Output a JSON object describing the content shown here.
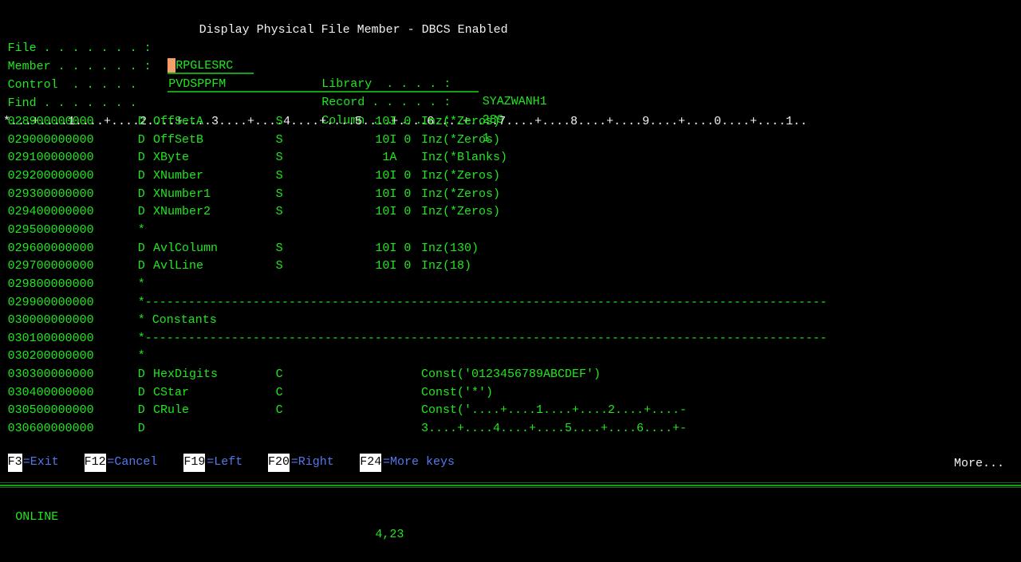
{
  "screen": {
    "title": "Display Physical File Member - DBCS Enabled",
    "more_indicator": "More...",
    "char_width": 9.6,
    "colors": {
      "green": "#1ee81e",
      "white": "#f2f2f2",
      "blue": "#5577ee",
      "cursor": "#f5a06a",
      "background": "#000000",
      "fkey_badge_bg": "#ffffff",
      "fkey_badge_fg": "#000000"
    }
  },
  "header": {
    "fields": [
      {
        "label": "File . . . . . . . :",
        "value": "QRPGLESRC"
      },
      {
        "label": "Member . . . . . . :",
        "value": "PVDSPPFM"
      },
      {
        "label": "Control  . . . . .",
        "value": ""
      },
      {
        "label": "Find . . . . . . .",
        "value": ""
      }
    ],
    "right_fields": [
      {
        "label": "Library  . . . . :",
        "value": "SYAZWANH1"
      },
      {
        "label": "Record . . . . . :",
        "value": "289"
      },
      {
        "label": "Column . . . . . :",
        "value": "1"
      }
    ]
  },
  "ruler": "*...+....1....+....2....+....3....+....4....+....5....+....6....+....7....+....8....+....9....+....0....+....1..",
  "listing": [
    {
      "seq": "028900000000",
      "spec": "D",
      "name": "OffSetA",
      "type": "S",
      "len": "10I 0",
      "keyword": "Inz(*Zeros)"
    },
    {
      "seq": "029000000000",
      "spec": "D",
      "name": "OffSetB",
      "type": "S",
      "len": "10I 0",
      "keyword": "Inz(*Zeros)"
    },
    {
      "seq": "029100000000",
      "spec": "D",
      "name": "XByte",
      "type": "S",
      "len": " 1A ",
      "keyword": "Inz(*Blanks)"
    },
    {
      "seq": "029200000000",
      "spec": "D",
      "name": "XNumber",
      "type": "S",
      "len": "10I 0",
      "keyword": "Inz(*Zeros)"
    },
    {
      "seq": "029300000000",
      "spec": "D",
      "name": "XNumber1",
      "type": "S",
      "len": "10I 0",
      "keyword": "Inz(*Zeros)"
    },
    {
      "seq": "029400000000",
      "spec": "D",
      "name": "XNumber2",
      "type": "S",
      "len": "10I 0",
      "keyword": "Inz(*Zeros)"
    },
    {
      "seq": "029500000000",
      "spec": "*",
      "name": "",
      "type": "",
      "len": "",
      "keyword": ""
    },
    {
      "seq": "029600000000",
      "spec": "D",
      "name": "AvlColumn",
      "type": "S",
      "len": "10I 0",
      "keyword": "Inz(130)"
    },
    {
      "seq": "029700000000",
      "spec": "D",
      "name": "AvlLine",
      "type": "S",
      "len": "10I 0",
      "keyword": "Inz(18)"
    },
    {
      "seq": "029800000000",
      "spec": "*",
      "name": "",
      "type": "",
      "len": "",
      "keyword": ""
    },
    {
      "seq": "029900000000",
      "spec": "*-----------------------------------------------------------------------------------------------",
      "name": "",
      "type": "",
      "len": "",
      "keyword": ""
    },
    {
      "seq": "030000000000",
      "spec": "* Constants",
      "name": "",
      "type": "",
      "len": "",
      "keyword": ""
    },
    {
      "seq": "030100000000",
      "spec": "*-----------------------------------------------------------------------------------------------",
      "name": "",
      "type": "",
      "len": "",
      "keyword": ""
    },
    {
      "seq": "030200000000",
      "spec": "*",
      "name": "",
      "type": "",
      "len": "",
      "keyword": ""
    },
    {
      "seq": "030300000000",
      "spec": "D",
      "name": "HexDigits",
      "type": "C",
      "len": "",
      "keyword": "Const('0123456789ABCDEF')"
    },
    {
      "seq": "030400000000",
      "spec": "D",
      "name": "CStar",
      "type": "C",
      "len": "",
      "keyword": "Const('*')"
    },
    {
      "seq": "030500000000",
      "spec": "D",
      "name": "CRule",
      "type": "C",
      "len": "",
      "keyword": "Const('....+....1....+....2....+....-"
    },
    {
      "seq": "030600000000",
      "spec": "D",
      "name": "",
      "type": "",
      "len": "",
      "keyword": "3....+....4....+....5....+....6....+-"
    }
  ],
  "function_keys": [
    {
      "key": "F3",
      "label": "=Exit"
    },
    {
      "key": "F12",
      "label": "=Cancel"
    },
    {
      "key": "F19",
      "label": "=Left"
    },
    {
      "key": "F20",
      "label": "=Right"
    },
    {
      "key": "F24",
      "label": "=More keys"
    }
  ],
  "status_bar": {
    "state": "ONLINE",
    "cursor_position": "4,23"
  }
}
